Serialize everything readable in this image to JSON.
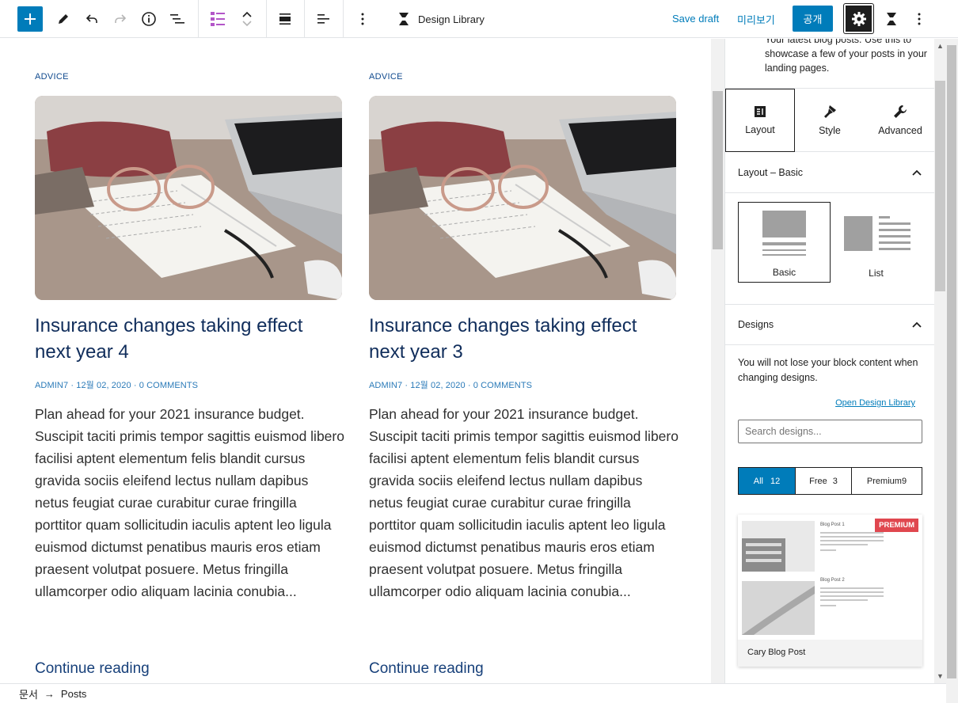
{
  "toolbar": {
    "design_library_label": "Design Library",
    "save_draft": "Save draft",
    "preview": "미리보기",
    "publish": "공개"
  },
  "posts": [
    {
      "category": "ADVICE",
      "title": "Insurance changes taking effect next year 4",
      "meta": "ADMIN7 · 12월 02, 2020 · 0 COMMENTS",
      "excerpt": "Plan ahead for your 2021 insurance budget. Suscipit taciti primis tempor sagittis euismod libero facilisi aptent elementum felis blandit cursus gravida sociis eleifend lectus nullam dapibus netus feugiat curae curabitur curae fringilla porttitor quam sollicitudin iaculis aptent leo ligula euismod dictumst penatibus mauris eros etiam praesent volutpat posuere. Metus fringilla ullamcorper odio aliquam lacinia conubia...",
      "more": "Continue reading"
    },
    {
      "category": "ADVICE",
      "title": "Insurance changes taking effect next year 3",
      "meta": "ADMIN7 · 12월 02, 2020 · 0 COMMENTS",
      "excerpt": "Plan ahead for your 2021 insurance budget. Suscipit taciti primis tempor sagittis euismod libero facilisi aptent elementum felis blandit cursus gravida sociis eleifend lectus nullam dapibus netus feugiat curae curabitur curae fringilla porttitor quam sollicitudin iaculis aptent leo ligula euismod dictumst penatibus mauris eros etiam praesent volutpat posuere. Metus fringilla ullamcorper odio aliquam lacinia conubia...",
      "more": "Continue reading"
    }
  ],
  "sidebar": {
    "description": "Your latest blog posts. Use this to showcase a few of your posts in your landing pages.",
    "tabs": [
      "Layout",
      "Style",
      "Advanced"
    ],
    "layout_panel_title": "Layout – Basic",
    "layout_options": [
      "Basic",
      "List"
    ],
    "designs_panel_title": "Designs",
    "designs_note": "You will not lose your block content when changing designs.",
    "open_design_library": "Open Design Library",
    "search_placeholder": "Search designs...",
    "filters": [
      {
        "label": "All",
        "count": "12"
      },
      {
        "label": "Free",
        "count": "3"
      },
      {
        "label": "Premium",
        "count": "9"
      }
    ],
    "card": {
      "badge": "PREMIUM",
      "name": "Cary Blog Post",
      "mini_titles": [
        "Blog Post 1",
        "Blog Post 2"
      ]
    }
  },
  "breadcrumb": {
    "root": "문서",
    "separator": "→",
    "current": "Posts"
  },
  "colors": {
    "accent": "#007cba",
    "title": "#102d5b",
    "premium": "#e0474f"
  }
}
